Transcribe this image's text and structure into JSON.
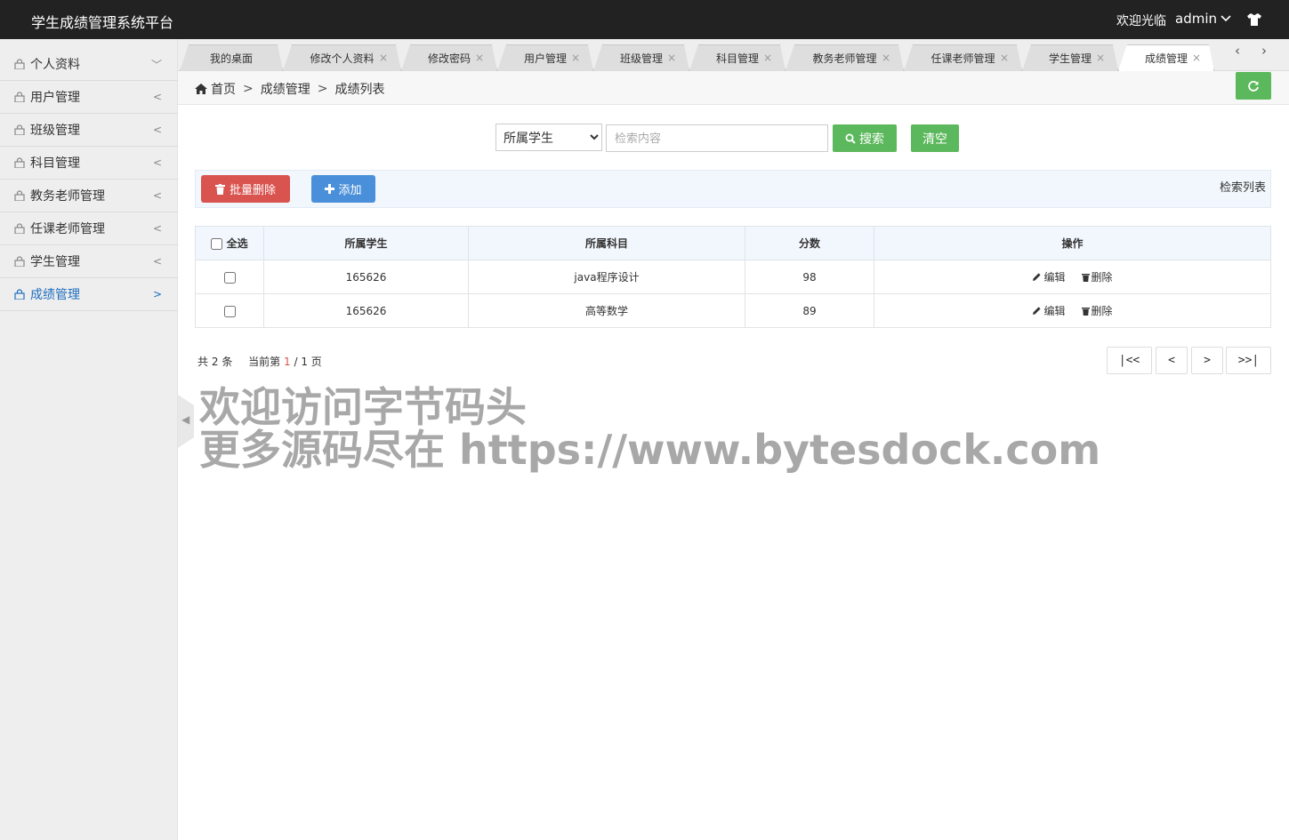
{
  "header": {
    "title": "学生成绩管理系统平台",
    "welcome": "欢迎光临",
    "username": "admin"
  },
  "sidebar": {
    "items": [
      {
        "label": "个人资料",
        "arrow": "﹀",
        "active": false
      },
      {
        "label": "用户管理",
        "arrow": "<",
        "active": false
      },
      {
        "label": "班级管理",
        "arrow": "<",
        "active": false
      },
      {
        "label": "科目管理",
        "arrow": "<",
        "active": false
      },
      {
        "label": "教务老师管理",
        "arrow": "<",
        "active": false
      },
      {
        "label": "任课老师管理",
        "arrow": "<",
        "active": false
      },
      {
        "label": "学生管理",
        "arrow": "<",
        "active": false
      },
      {
        "label": "成绩管理",
        "arrow": ">",
        "active": true
      }
    ]
  },
  "tabs": [
    {
      "label": "我的桌面",
      "closable": false
    },
    {
      "label": "修改个人资料",
      "closable": true
    },
    {
      "label": "修改密码",
      "closable": true
    },
    {
      "label": "用户管理",
      "closable": true
    },
    {
      "label": "班级管理",
      "closable": true
    },
    {
      "label": "科目管理",
      "closable": true
    },
    {
      "label": "教务老师管理",
      "closable": true
    },
    {
      "label": "任课老师管理",
      "closable": true
    },
    {
      "label": "学生管理",
      "closable": true
    },
    {
      "label": "成绩管理",
      "closable": true,
      "active": true
    }
  ],
  "tabnav": {
    "prev": "‹",
    "next": "›"
  },
  "breadcrumb": {
    "home": "首页",
    "section": "成绩管理",
    "page": "成绩列表",
    "sep": ">"
  },
  "search": {
    "field_selected": "所属学生",
    "placeholder": "检索内容",
    "search_label": "搜索",
    "clear_label": "清空"
  },
  "toolbar": {
    "batch_delete_label": "批量删除",
    "add_label": "添加",
    "caption": "检索列表"
  },
  "table": {
    "select_all": "全选",
    "columns": [
      "所属学生",
      "所属科目",
      "分数",
      "操作"
    ],
    "rows": [
      {
        "student": "165626",
        "subject": "java程序设计",
        "score": "98"
      },
      {
        "student": "165626",
        "subject": "高等数学",
        "score": "89"
      }
    ],
    "edit_label": "编辑",
    "delete_label": "删除"
  },
  "pager": {
    "total_prefix": "共",
    "total": "2",
    "total_suffix": "条",
    "current_prefix": "当前第",
    "current": "1",
    "pages": "/ 1 页",
    "first": "|<<",
    "prev": "<",
    "next": ">",
    "last": ">>|"
  },
  "watermark": {
    "line1": "欢迎访问字节码头",
    "line2": "更多源码尽在 https://www.bytesdock.com"
  },
  "colors": {
    "header_bg": "#222222",
    "sidebar_bg": "#eeeeee",
    "active_link": "#1f6ebf",
    "success": "#5cb85c",
    "danger": "#d9534f",
    "primary": "#4a8fd9"
  }
}
